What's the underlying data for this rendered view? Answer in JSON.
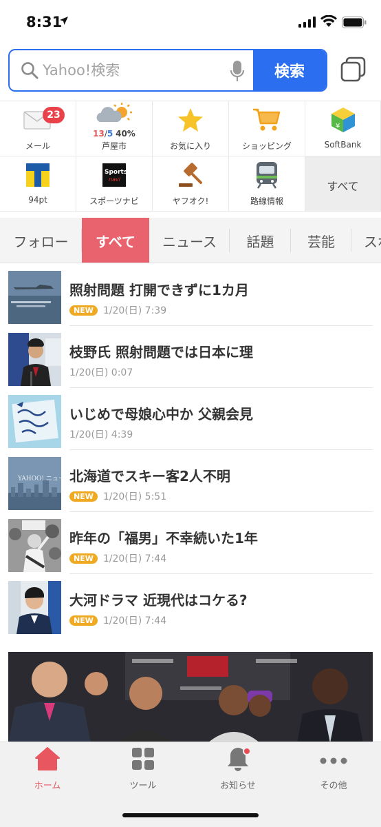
{
  "status_bar": {
    "time": "8:31"
  },
  "search": {
    "placeholder": "Yahoo!検索",
    "button_label": "検索"
  },
  "shortcuts": {
    "mail": {
      "label": "メール",
      "badge": "23"
    },
    "weather": {
      "high": "13",
      "sep": "/",
      "low": "5",
      "precip": "40%",
      "label": "芦屋市"
    },
    "favorites": {
      "label": "お気に入り"
    },
    "shopping": {
      "label": "ショッピング"
    },
    "softbank": {
      "label": "SoftBank"
    },
    "tpoint": {
      "label": "94pt"
    },
    "sports": {
      "label": "スポーツナビ",
      "logo_text": "Sports navi"
    },
    "auction": {
      "label": "ヤフオク!"
    },
    "transit": {
      "label": "路線情報"
    },
    "all": {
      "label": "すべて"
    }
  },
  "categories": [
    "フォロー",
    "すべて",
    "ニュース",
    "話題",
    "芸能",
    "スポ"
  ],
  "active_category": "すべて",
  "news": [
    {
      "title": "照射問題 打開できずに1カ月",
      "is_new": true,
      "new_label": "NEW",
      "date": "1/20(日) 7:39"
    },
    {
      "title": "枝野氏 照射問題では日本に理",
      "is_new": false,
      "date": "1/20(日) 0:07"
    },
    {
      "title": "いじめで母娘心中か 父親会見",
      "is_new": false,
      "date": "1/20(日) 4:39"
    },
    {
      "title": "北海道でスキー客2人不明",
      "is_new": true,
      "new_label": "NEW",
      "date": "1/20(日) 5:51"
    },
    {
      "title": "昨年の「福男」不幸続いた1年",
      "is_new": true,
      "new_label": "NEW",
      "date": "1/20(日) 7:44"
    },
    {
      "title": "大河ドラマ 近現代はコケる?",
      "is_new": true,
      "new_label": "NEW",
      "date": "1/20(日) 7:44"
    }
  ],
  "bottom_nav": [
    {
      "label": "ホーム",
      "icon": "home-icon",
      "active": true
    },
    {
      "label": "ツール",
      "icon": "tools-icon",
      "active": false
    },
    {
      "label": "お知らせ",
      "icon": "bell-icon",
      "active": false
    },
    {
      "label": "その他",
      "icon": "more-icon",
      "active": false
    }
  ],
  "colors": {
    "accent": "#2b6ef0",
    "active_tab": "#e9636e",
    "badge": "#e9424a",
    "new_badge": "#f0a923"
  }
}
